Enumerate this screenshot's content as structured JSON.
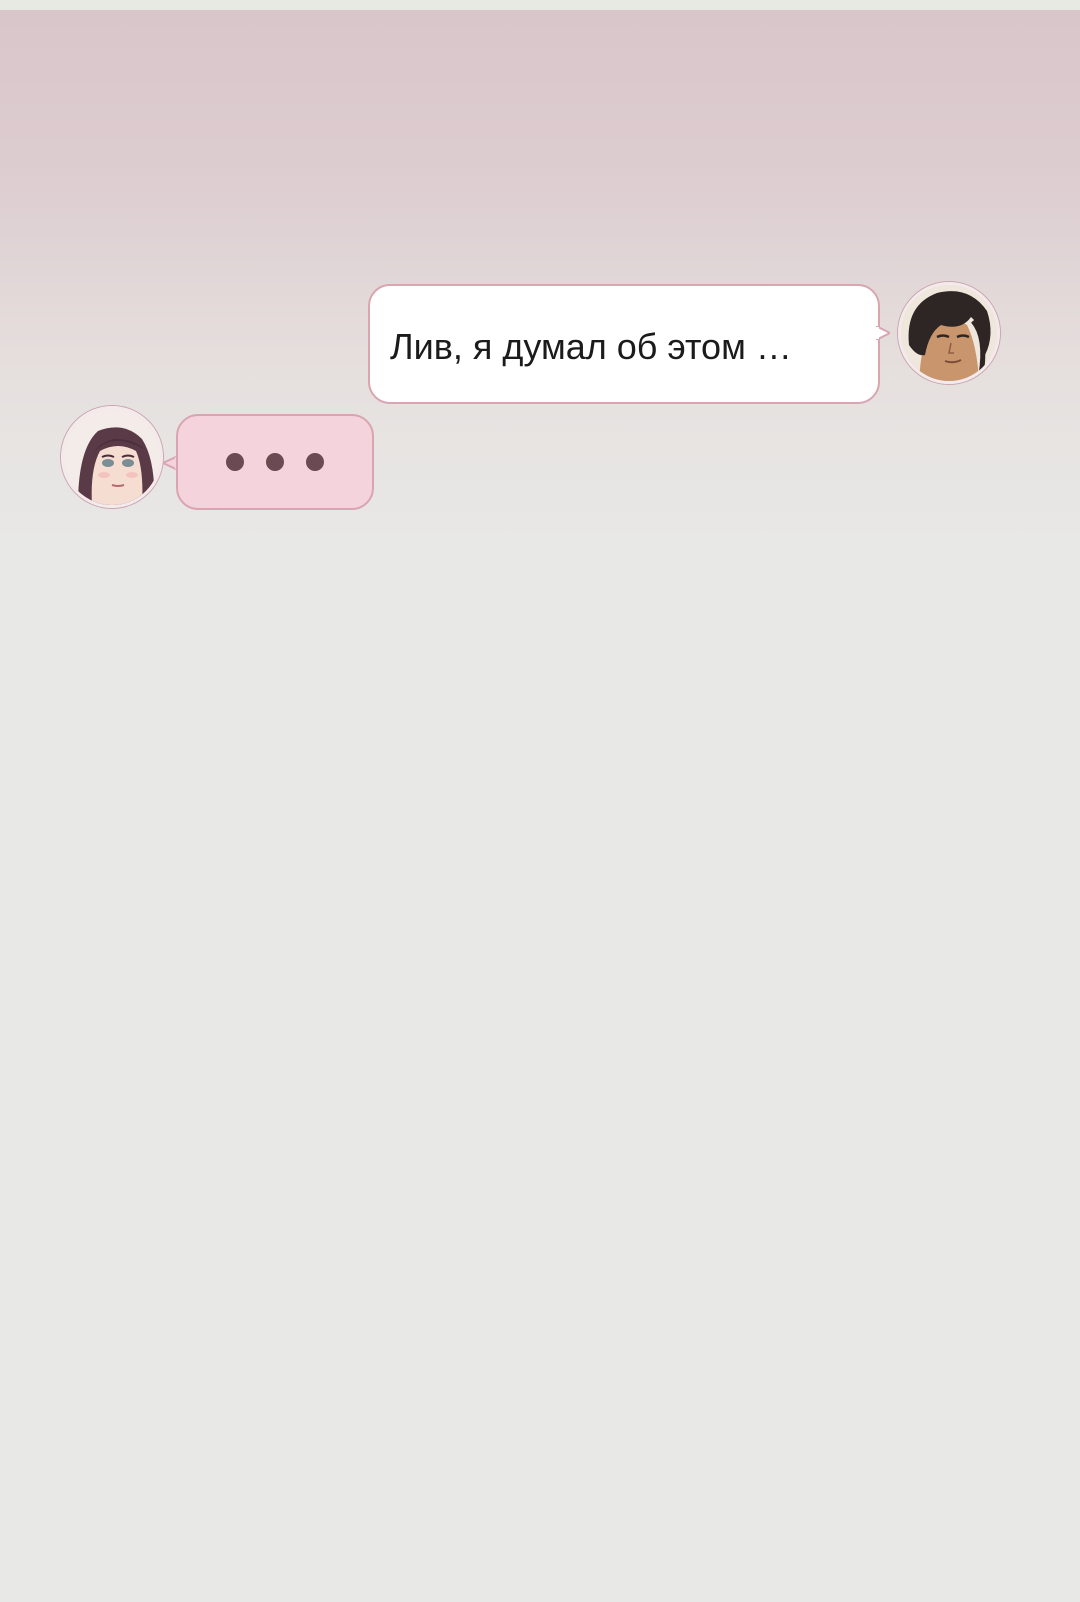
{
  "chat": {
    "messages": [
      {
        "sender": "male",
        "avatar_icon": "male-character-portrait-icon",
        "text": "Лив, я думал об этом …",
        "bubble_color": "#ffffff"
      },
      {
        "sender": "female",
        "avatar_icon": "female-character-portrait-icon",
        "typing_indicator": "typing-dots-icon",
        "bubble_color": "#f5d3dc"
      }
    ]
  },
  "colors": {
    "bubble_border": "#d9a5b0",
    "background_top": "#d9c6cb",
    "background_bottom": "#e8e8e6",
    "typing_dots": "#6b4a51"
  }
}
